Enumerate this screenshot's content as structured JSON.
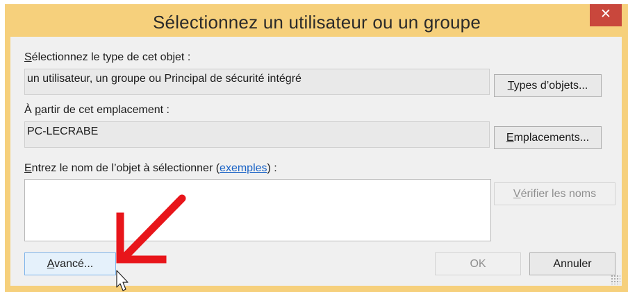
{
  "dialog": {
    "title": "Sélectionnez un utilisateur ou un groupe",
    "close_glyph": "✕"
  },
  "object_type": {
    "label_accel": "S",
    "label_rest": "électionnez le type de cet objet :",
    "value": "un utilisateur, un groupe ou Principal de sécurité intégré",
    "button_accel": "T",
    "button_rest": "ypes d’objets..."
  },
  "location": {
    "label_pre": "À ",
    "label_accel": "p",
    "label_rest": "artir de cet emplacement :",
    "value": "PC-LECRABE",
    "button_accel": "E",
    "button_rest": "mplacements..."
  },
  "object_names": {
    "label_accel": "E",
    "label_mid": "ntrez le nom de l’objet à sélectionner (",
    "link": "exemples",
    "label_end": ") :",
    "value": "",
    "check_button_accel": "V",
    "check_button_rest": "érifier les noms"
  },
  "footer": {
    "advanced_accel": "A",
    "advanced_rest": "vancé...",
    "ok_label": "OK",
    "cancel_label": "Annuler"
  },
  "annotation": {
    "arrow_color": "#e8151a"
  },
  "icons": [
    "close-icon",
    "red-arrow-annotation",
    "mouse-cursor-icon",
    "resize-grip-icon"
  ]
}
